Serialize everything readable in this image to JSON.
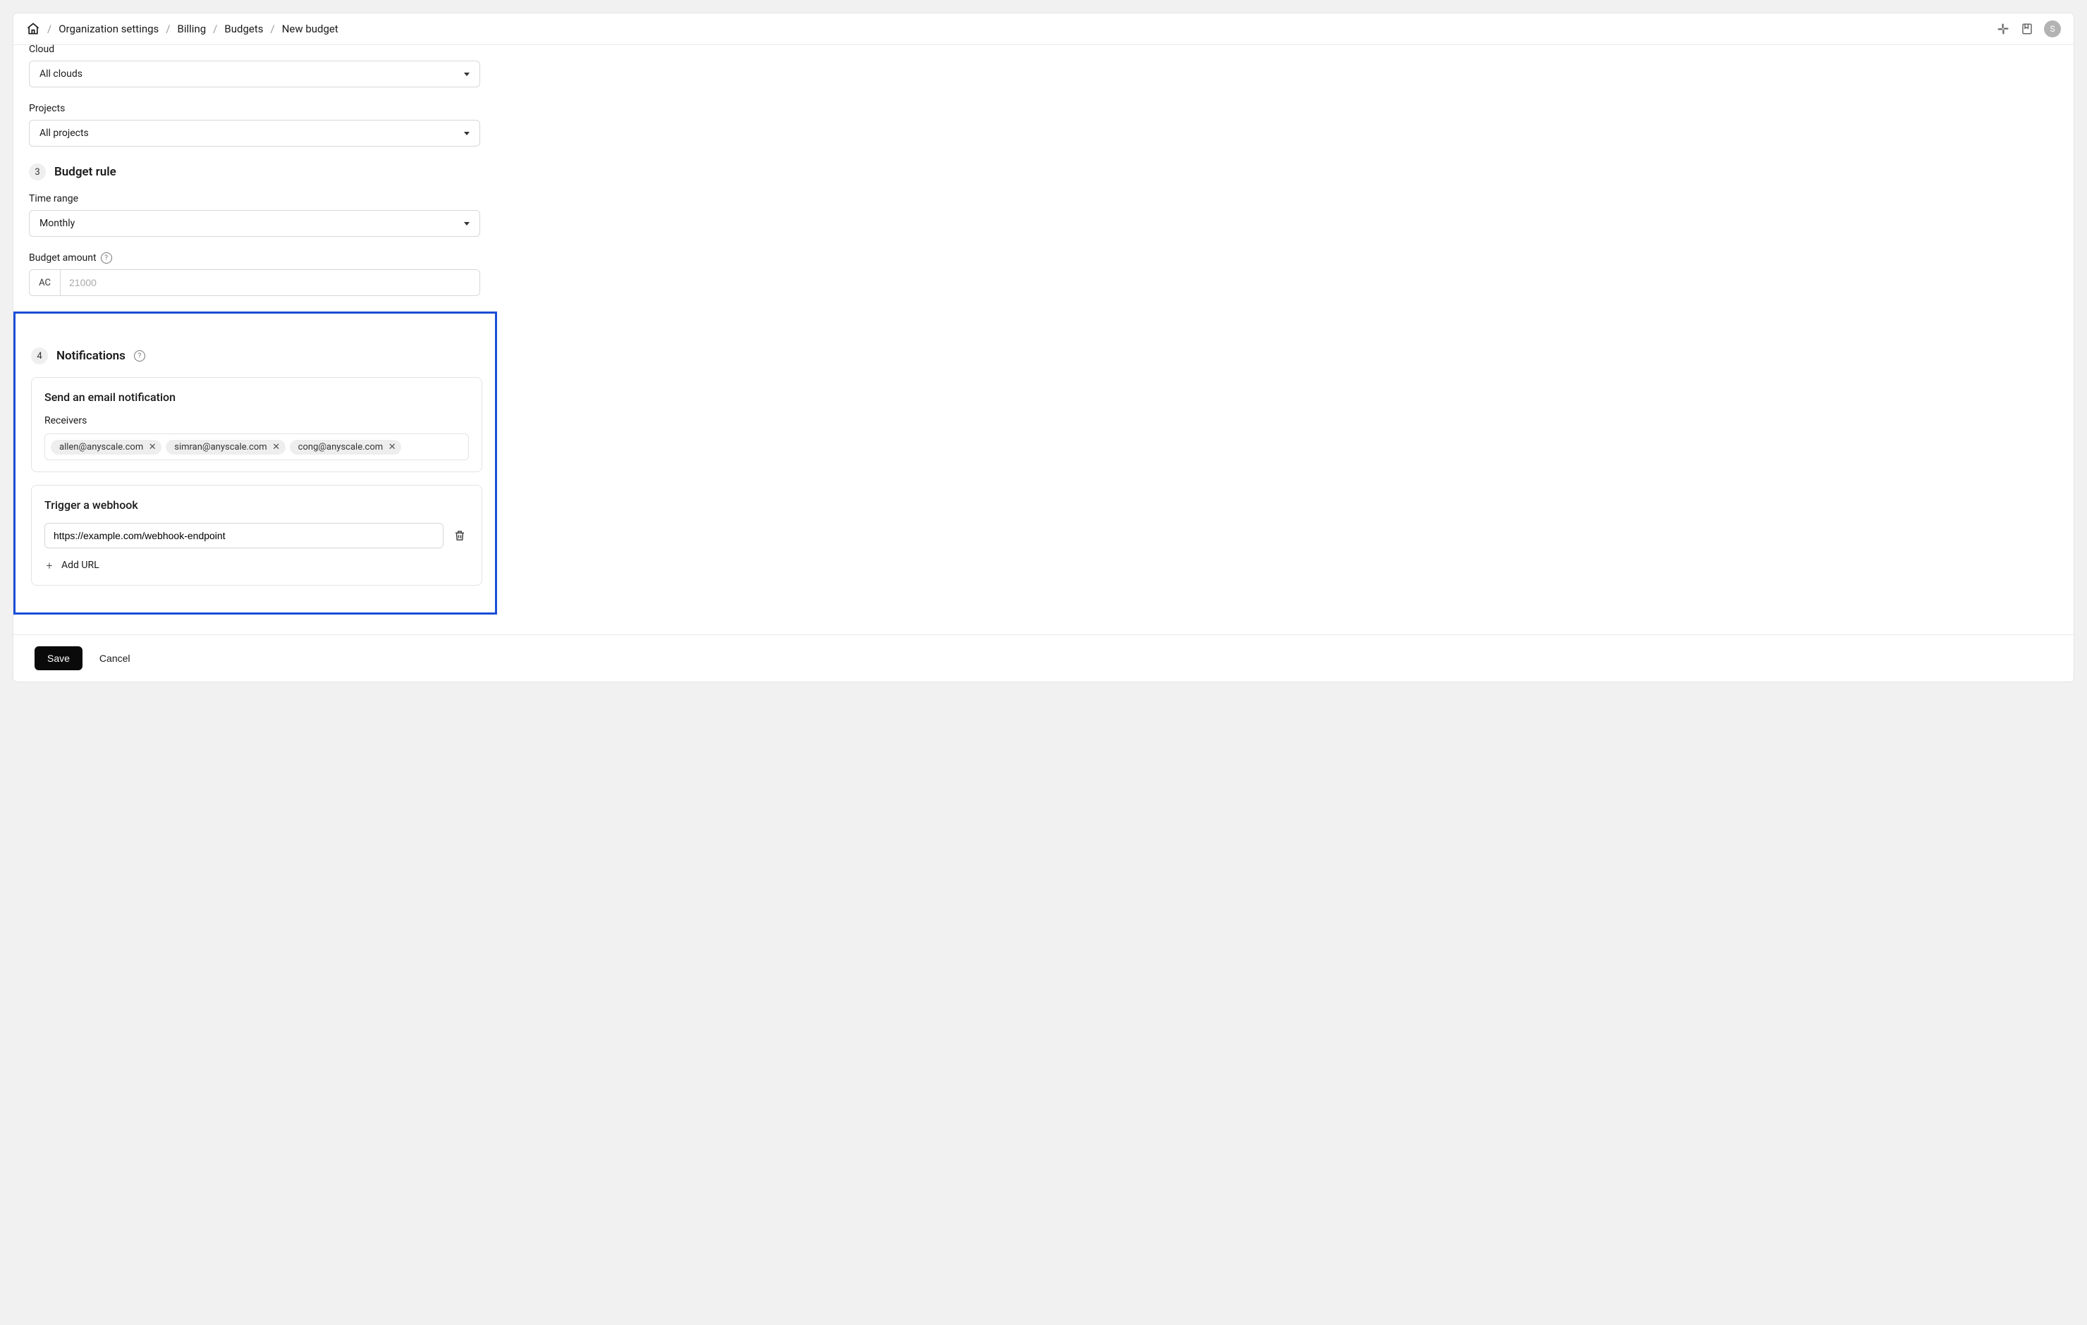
{
  "breadcrumb": {
    "items": [
      "Organization settings",
      "Billing",
      "Budgets",
      "New budget"
    ]
  },
  "avatar_initial": "S",
  "fields": {
    "cloud_label": "Cloud",
    "cloud_value": "All clouds",
    "projects_label": "Projects",
    "projects_value": "All projects",
    "time_range_label": "Time range",
    "time_range_value": "Monthly",
    "budget_amount_label": "Budget amount",
    "budget_prefix": "AC",
    "budget_placeholder": "21000"
  },
  "sections": {
    "budget_rule": {
      "step": "3",
      "title": "Budget rule"
    },
    "notifications": {
      "step": "4",
      "title": "Notifications"
    }
  },
  "email_card": {
    "title": "Send an email notification",
    "receivers_label": "Receivers",
    "receivers": [
      "allen@anyscale.com",
      "simran@anyscale.com",
      "cong@anyscale.com"
    ]
  },
  "webhook_card": {
    "title": "Trigger a webhook",
    "url_value": "https://example.com/webhook-endpoint",
    "add_url_label": "Add URL"
  },
  "footer": {
    "save": "Save",
    "cancel": "Cancel"
  }
}
